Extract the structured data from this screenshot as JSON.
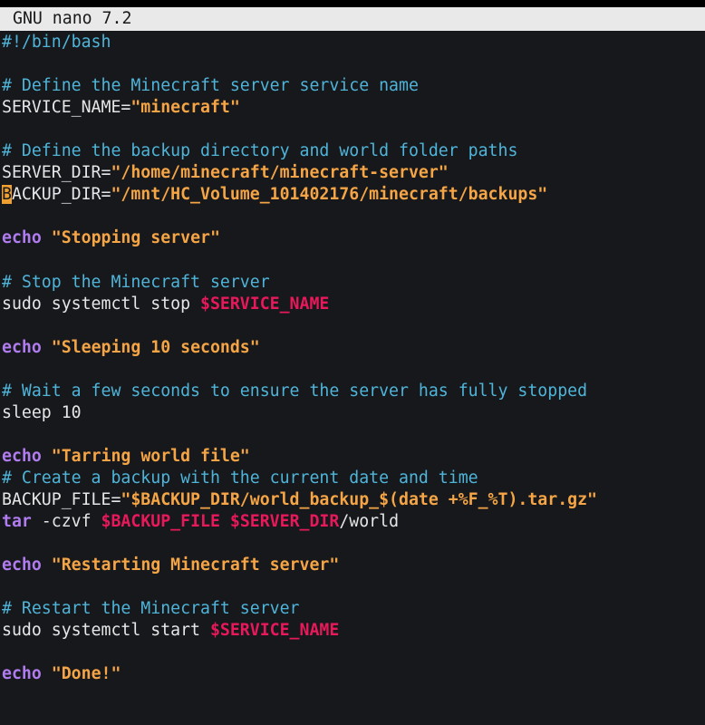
{
  "window": {
    "title": "GNU nano 7.2"
  },
  "colors": {
    "background": "#16181c",
    "titlebar": "#e9e9e9",
    "comment": "#4fb4d8",
    "keyword": "#b07cf0",
    "string": "#f5a545",
    "variable": "#e8195a",
    "cursor": "#f0a030"
  },
  "editor": {
    "cursor": {
      "line": 8,
      "column": 1
    },
    "lines": [
      [
        {
          "t": "#!/bin/bash",
          "s": "comment"
        }
      ],
      [],
      [
        {
          "t": "# Define the Minecraft server service name",
          "s": "comment"
        }
      ],
      [
        {
          "t": "SERVICE_NAME=",
          "s": "plain"
        },
        {
          "t": "\"minecraft\"",
          "s": "string"
        }
      ],
      [],
      [
        {
          "t": "# Define the backup directory and world folder paths",
          "s": "comment"
        }
      ],
      [
        {
          "t": "SERVER_DIR=",
          "s": "plain"
        },
        {
          "t": "\"/home/minecraft/minecraft-server\"",
          "s": "string"
        }
      ],
      [
        {
          "t": "B",
          "s": "cursor"
        },
        {
          "t": "ACKUP_DIR=",
          "s": "plain"
        },
        {
          "t": "\"/mnt/HC_Volume_101402176/minecraft/backups\"",
          "s": "string"
        }
      ],
      [],
      [
        {
          "t": "echo",
          "s": "keyword"
        },
        {
          "t": " ",
          "s": "plain"
        },
        {
          "t": "\"Stopping server\"",
          "s": "string"
        }
      ],
      [],
      [
        {
          "t": "# Stop the Minecraft server",
          "s": "comment"
        }
      ],
      [
        {
          "t": "sudo systemctl stop ",
          "s": "plain"
        },
        {
          "t": "$SERVICE_NAME",
          "s": "var"
        }
      ],
      [],
      [
        {
          "t": "echo",
          "s": "keyword"
        },
        {
          "t": " ",
          "s": "plain"
        },
        {
          "t": "\"Sleeping 10 seconds\"",
          "s": "string"
        }
      ],
      [],
      [
        {
          "t": "# Wait a few seconds to ensure the server has fully stopped",
          "s": "comment"
        }
      ],
      [
        {
          "t": "sleep 10",
          "s": "plain"
        }
      ],
      [],
      [
        {
          "t": "echo",
          "s": "keyword"
        },
        {
          "t": " ",
          "s": "plain"
        },
        {
          "t": "\"Tarring world file\"",
          "s": "string"
        }
      ],
      [
        {
          "t": "# Create a backup with the current date and time",
          "s": "comment"
        }
      ],
      [
        {
          "t": "BACKUP_FILE=",
          "s": "plain"
        },
        {
          "t": "\"$BACKUP_DIR/world_backup_$(date +%F_%T).tar.gz\"",
          "s": "string"
        }
      ],
      [
        {
          "t": "tar",
          "s": "keyword"
        },
        {
          "t": " -czvf ",
          "s": "plain"
        },
        {
          "t": "$BACKUP_FILE",
          "s": "var"
        },
        {
          "t": " ",
          "s": "plain"
        },
        {
          "t": "$SERVER_DIR",
          "s": "var"
        },
        {
          "t": "/world",
          "s": "plain"
        }
      ],
      [],
      [
        {
          "t": "echo",
          "s": "keyword"
        },
        {
          "t": " ",
          "s": "plain"
        },
        {
          "t": "\"Restarting Minecraft server\"",
          "s": "string"
        }
      ],
      [],
      [
        {
          "t": "# Restart the Minecraft server",
          "s": "comment"
        }
      ],
      [
        {
          "t": "sudo systemctl start ",
          "s": "plain"
        },
        {
          "t": "$SERVICE_NAME",
          "s": "var"
        }
      ],
      [],
      [
        {
          "t": "echo",
          "s": "keyword"
        },
        {
          "t": " ",
          "s": "plain"
        },
        {
          "t": "\"Done!\"",
          "s": "string"
        }
      ]
    ]
  }
}
